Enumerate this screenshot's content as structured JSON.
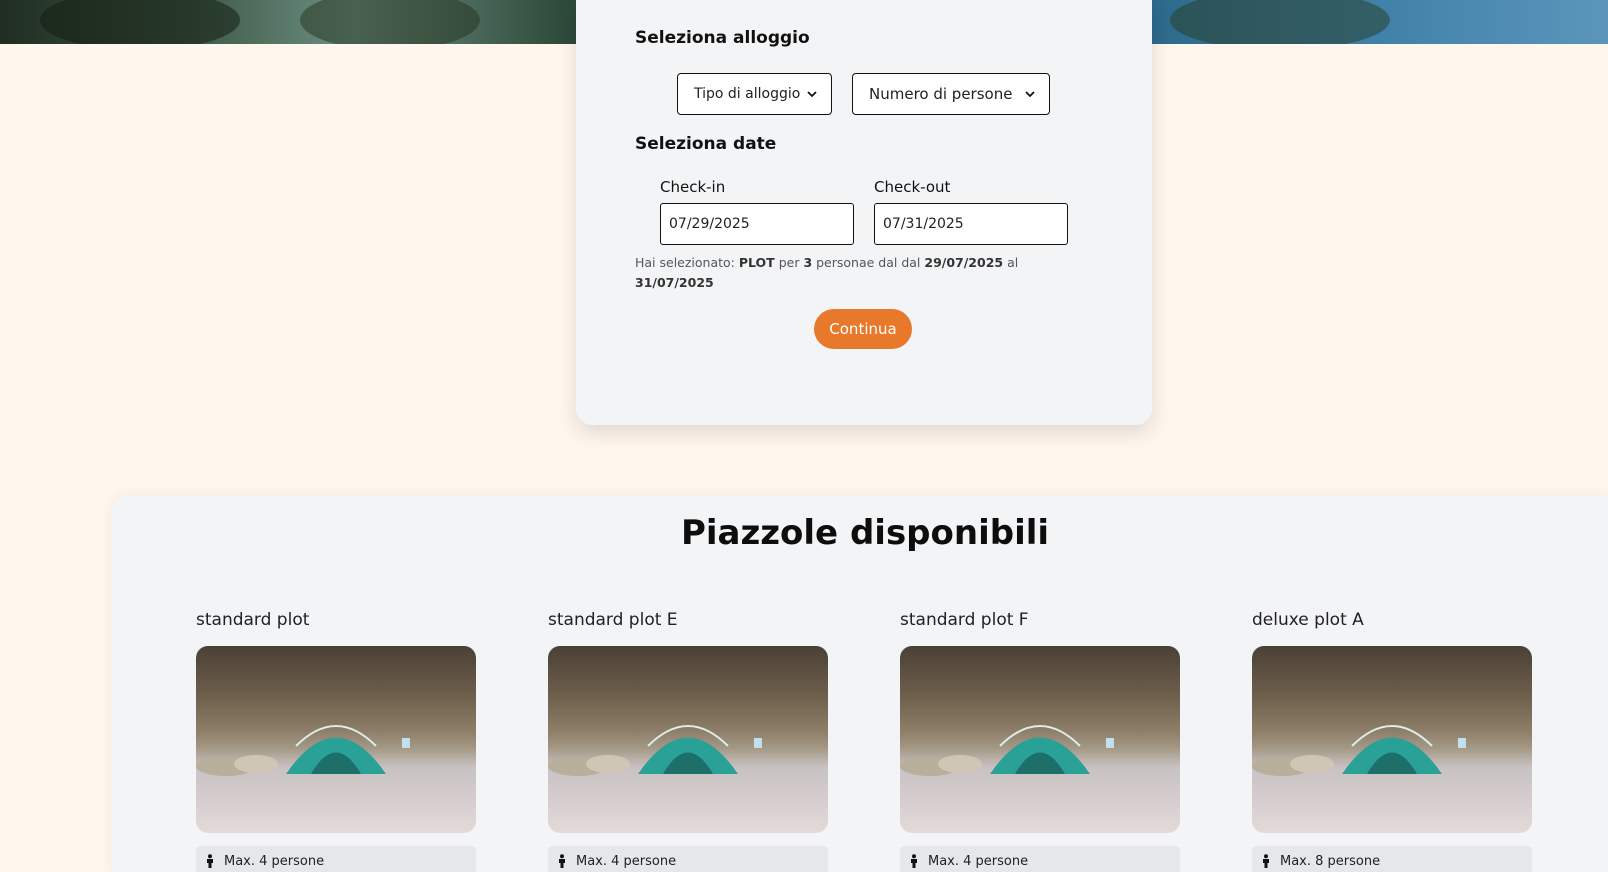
{
  "booking": {
    "accommodation_title": "Seleziona alloggio",
    "type_select": "Tipo di alloggio",
    "people_select": "Numero di persone",
    "dates_title": "Seleziona date",
    "checkin_label": "Check-in",
    "checkin_value": "07/29/2025",
    "checkout_label": "Check-out",
    "checkout_value": "07/31/2025",
    "summary": {
      "prefix": "Hai selezionato: ",
      "type": "PLOT",
      "per": " per ",
      "people": "3",
      "mid": " personae dal dal ",
      "from": "29/07/2025",
      "al": " al ",
      "to": "31/07/2025"
    },
    "continue_label": "Continua"
  },
  "plots": {
    "title": "Piazzole disponibili",
    "items": [
      {
        "name": "standard plot",
        "capacity": "Max. 4 persone"
      },
      {
        "name": "standard plot E",
        "capacity": "Max. 4 persone"
      },
      {
        "name": "standard plot F",
        "capacity": "Max. 4 persone"
      },
      {
        "name": "deluxe plot A",
        "capacity": "Max. 8 persone"
      }
    ]
  },
  "colors": {
    "background": "#fff6ee",
    "card": "#f3f4f6",
    "accent": "#e8782a"
  }
}
